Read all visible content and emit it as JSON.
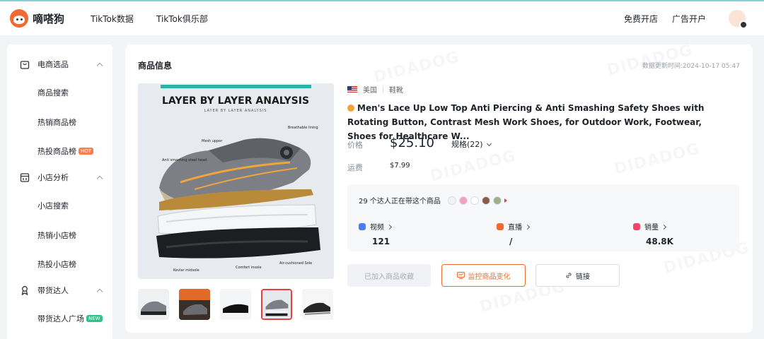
{
  "app": {
    "brand": "嘀嗒狗"
  },
  "topnav": {
    "items": [
      "TikTok数据",
      "TikTok俱乐部"
    ],
    "right": [
      "免费开店",
      "广告开户"
    ]
  },
  "sidebar": {
    "groups": [
      {
        "label": "电商选品",
        "icon": "shopping-bag-icon",
        "items": [
          {
            "label": "商品搜索"
          },
          {
            "label": "热销商品榜"
          },
          {
            "label": "热投商品榜",
            "badge": "HOT"
          }
        ]
      },
      {
        "label": "小店分析",
        "icon": "shop-icon",
        "items": [
          {
            "label": "小店搜索"
          },
          {
            "label": "热销小店榜"
          },
          {
            "label": "热投小店榜"
          }
        ]
      },
      {
        "label": "带货达人",
        "icon": "influencer-icon",
        "items": [
          {
            "label": "带货达人广场",
            "badge": "NEW"
          }
        ]
      }
    ]
  },
  "product": {
    "section_title": "商品信息",
    "updated": "数据更新时间:2024-10-17 05:47",
    "country": "美国",
    "category": "鞋靴",
    "title": "Men's Lace Up Low Top Anti Piercing & Anti Smashing Safety Shoes with Rotating Button, Contrast Mesh Work Shoes, for Outdoor Work, Footwear, Shoes for Healthcare W...",
    "price_label": "价格",
    "price": "$25.10",
    "spec": "规格(22)",
    "shipping_label": "运费",
    "shipping": "$7.99",
    "image": {
      "headline": "LAYER BY LAYER ANALYSIS",
      "subhead": "LAYER BY LAYER ANALYSIS",
      "callouts": [
        "Breathable lining",
        "Mesh upper",
        "Anti smashing steel head",
        "Kevlar midsole",
        "Comfort insole",
        "Air-cushioned Sole"
      ]
    },
    "thumbnails": 5,
    "active_thumbnail": 3
  },
  "stats": {
    "influencers": "29 个达人正在带这个商品",
    "items": [
      {
        "label": "视频",
        "value": "121",
        "color": "#4a7cf7"
      },
      {
        "label": "直播",
        "value": "/",
        "color": "#f06a31"
      },
      {
        "label": "销量",
        "value": "48.8K",
        "color": "#f0466a"
      }
    ]
  },
  "actions": {
    "added": "已加入商品收藏",
    "monitor": "监控商品变化",
    "link": "链接"
  },
  "watermark": "DIDADOG",
  "colors": {
    "accent": "#f06a31",
    "topline": "#7fd4d0"
  }
}
